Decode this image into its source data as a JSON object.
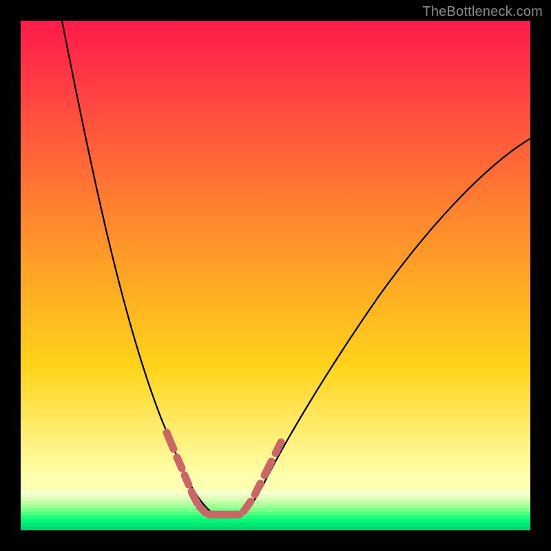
{
  "watermark": "TheBottleneck.com",
  "colors": {
    "background": "#000000",
    "gradient_top": "#ff1a4b",
    "gradient_mid1": "#ff8a2c",
    "gradient_mid2": "#ffd41a",
    "gradient_bottom": "#ffffb0",
    "green_band_top": "#f6ffd0",
    "green_band_bottom": "#00d96f",
    "marker": "#cc6666",
    "curve": "#000000",
    "watermark_text": "#888888"
  },
  "chart_data": {
    "type": "line",
    "title": "",
    "xlabel": "",
    "ylabel": "",
    "xlim": [
      0,
      100
    ],
    "ylim": [
      0,
      100
    ],
    "annotations": [
      "TheBottleneck.com"
    ],
    "series": [
      {
        "name": "bottleneck-curve",
        "x": [
          8,
          15,
          22,
          28,
          32,
          36,
          38,
          40,
          42,
          45,
          50,
          60,
          70,
          82,
          94,
          100
        ],
        "y": [
          101,
          80,
          58,
          40,
          25,
          12,
          6,
          3,
          2,
          4,
          10,
          25,
          42,
          58,
          72,
          77
        ]
      }
    ],
    "markers": {
      "name": "highlight-dashes",
      "color": "#cc6666",
      "description": "short thick salmon dashes tracing the curve near its minimum",
      "approx_x_range": [
        28,
        51
      ],
      "approx_y_range": [
        2,
        20
      ]
    },
    "background_gradient": {
      "direction": "vertical",
      "stops": [
        {
          "pos": 0.0,
          "color": "#ff1a4b"
        },
        {
          "pos": 0.4,
          "color": "#ff8a2c"
        },
        {
          "pos": 0.68,
          "color": "#ffd41a"
        },
        {
          "pos": 0.9,
          "color": "#ffffb0"
        },
        {
          "pos": 0.93,
          "color": "#d3ffb2"
        },
        {
          "pos": 1.0,
          "color": "#00d96f"
        }
      ]
    }
  }
}
